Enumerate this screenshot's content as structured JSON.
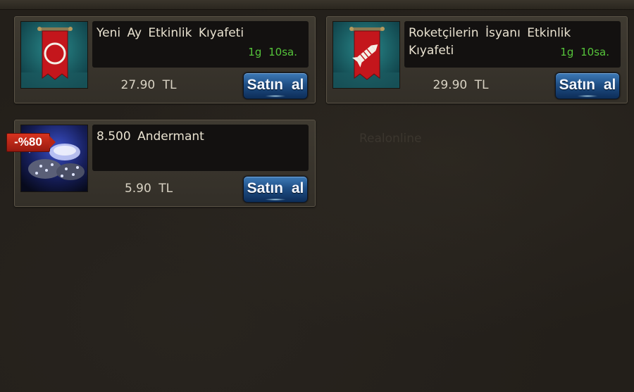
{
  "watermark": "Realonline",
  "products": [
    {
      "name": "Yeni Ay Etkinlik Kıyafeti",
      "time_left": "1g 10sa.",
      "price": "27.90 TL",
      "buy_label": "Satın al",
      "icon": "red-banner-circle-icon"
    },
    {
      "name": "Roketçilerin İsyanı Etkinlik Kıyafeti",
      "time_left": "1g 10sa.",
      "price": "29.90 TL",
      "buy_label": "Satın al",
      "icon": "red-banner-rocket-icon"
    },
    {
      "name": "8.500 Andermant",
      "time_left": "",
      "price": "5.90 TL",
      "buy_label": "Satın al",
      "discount": "-%80",
      "icon": "andermant-gems-icon"
    }
  ],
  "colors": {
    "background": "#231f1a",
    "card": "#3a352c",
    "timer": "#55c43a",
    "button": "#1f4f86",
    "discount": "#c62a17"
  }
}
